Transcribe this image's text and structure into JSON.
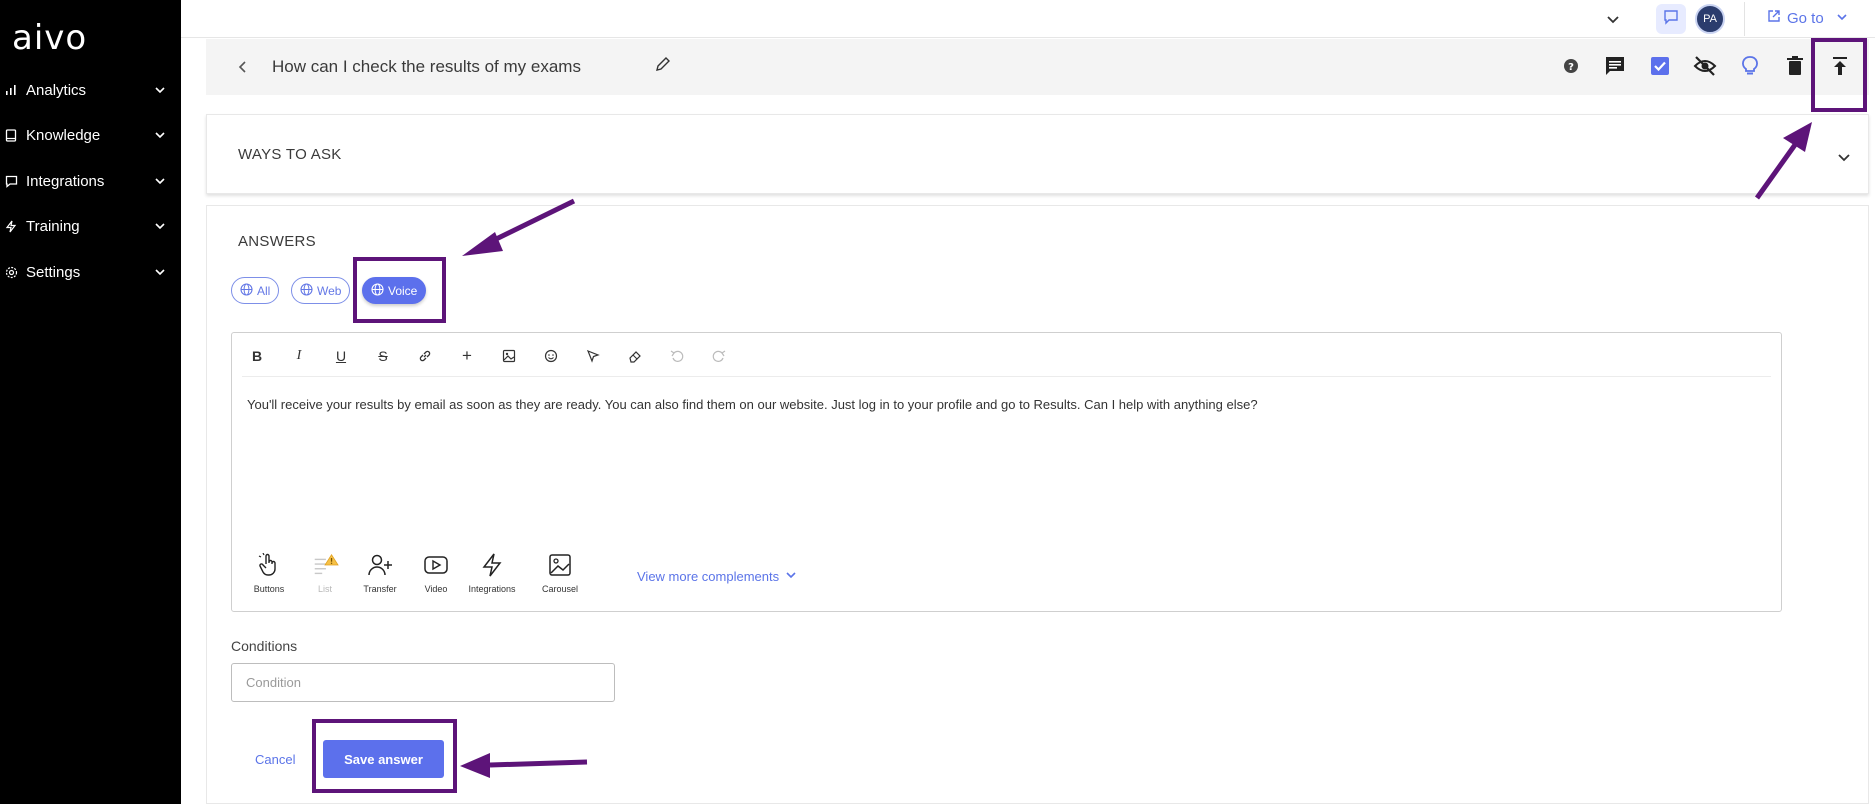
{
  "sidebar": {
    "logo": "aivo",
    "items": [
      {
        "label": "Analytics",
        "icon": "bar-chart-icon"
      },
      {
        "label": "Knowledge",
        "icon": "book-icon"
      },
      {
        "label": "Integrations",
        "icon": "chat-bubble-icon"
      },
      {
        "label": "Training",
        "icon": "lightning-icon"
      },
      {
        "label": "Settings",
        "icon": "gear-icon"
      }
    ]
  },
  "topbar": {
    "avatar_initials": "PA",
    "goto_label": "Go to"
  },
  "titlebar": {
    "title": "How can I check the results of my exams",
    "tools": [
      "help-icon",
      "comment-icon",
      "checkbox-icon",
      "eye-off-icon",
      "lightbulb-icon",
      "trash-icon",
      "publish-icon"
    ]
  },
  "ways_to_ask": {
    "title": "WAYS TO ASK"
  },
  "answers": {
    "title": "ANSWERS",
    "channels": [
      {
        "label": "All",
        "active": false
      },
      {
        "label": "Web",
        "active": false
      },
      {
        "label": "Voice",
        "active": true
      }
    ],
    "editor_toolbar": [
      "bold",
      "italic",
      "underline",
      "strikethrough",
      "link",
      "plus",
      "image",
      "emoji",
      "pointer",
      "eraser",
      "undo",
      "redo"
    ],
    "answer_text": "You'll receive your results by email as soon as they are ready. You can also find them on our website. Just log in to your profile and go to  Results. Can I help with anything else?",
    "complements": [
      {
        "label": "Buttons",
        "icon": "hand-pointer-icon"
      },
      {
        "label": "List",
        "icon": "list-warning-icon",
        "disabled": true
      },
      {
        "label": "Transfer",
        "icon": "user-plus-icon"
      },
      {
        "label": "Video",
        "icon": "video-icon"
      },
      {
        "label": "Integrations",
        "icon": "lightning-icon"
      },
      {
        "label": "Carousel",
        "icon": "image-icon"
      }
    ],
    "view_more": "View more complements",
    "conditions_label": "Conditions",
    "condition_placeholder": "Condition",
    "cancel": "Cancel",
    "save": "Save answer"
  },
  "colors": {
    "accent": "#5c70ec",
    "annotation": "#5d1479",
    "sidebar_bg": "#000000"
  }
}
